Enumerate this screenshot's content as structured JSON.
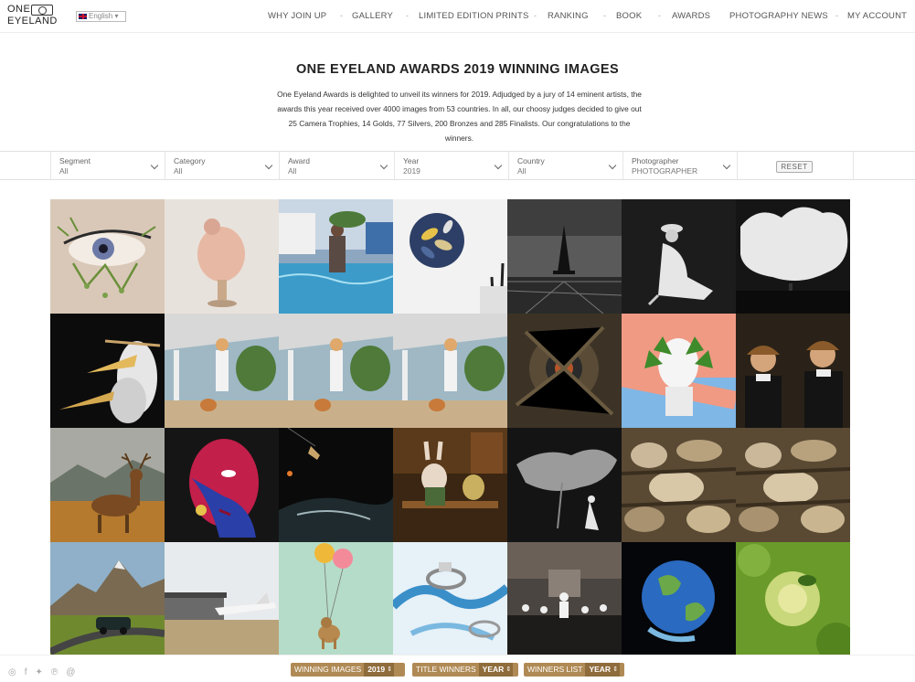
{
  "logo": {
    "line1": "ONE",
    "line2": "EYELAND"
  },
  "language": {
    "label": "English"
  },
  "nav": [
    "WHY JOIN UP",
    "GALLERY",
    "LIMITED EDITION PRINTS",
    "RANKING",
    "BOOK",
    "AWARDS",
    "PHOTOGRAPHY NEWS",
    "MY ACCOUNT"
  ],
  "page": {
    "title": "ONE EYELAND AWARDS 2019 WINNING IMAGES",
    "intro": "One Eyeland Awards is delighted to unveil its winners for 2019. Adjudged by a jury of 14 eminent artists, the awards this year received over 4000 images from 53 countries. In all, our choosy judges decided to give out 25 Camera Trophies, 14 Golds, 77 Silvers, 200 Bronzes and 285 Finalists. Our congratulations to the winners."
  },
  "filters": [
    {
      "label": "Segment",
      "value": "All"
    },
    {
      "label": "Category",
      "value": "All"
    },
    {
      "label": "Award",
      "value": "All"
    },
    {
      "label": "Year",
      "value": "2019"
    },
    {
      "label": "Country",
      "value": "All"
    },
    {
      "label": "Photographer",
      "value": "PHOTOGRAPHER"
    }
  ],
  "reset_label": "RESET",
  "gallery": {
    "tiles": [
      "eye-makeup",
      "crouching-figure",
      "poolside-woman",
      "mussel-shells",
      "eiffel-tower",
      "seated-woman-bw",
      "cloud-rider",
      "pelicans",
      "woman-with-dog",
      "woman-with-dog",
      "woman-with-dog",
      "aerial-tree",
      "green-leaf-bust",
      "boy-portraits",
      "red-deer",
      "painted-face",
      "aerial-diver",
      "rabbit-diorama",
      "tree-silhouette",
      "sculpted-figures",
      "sculpted-figures",
      "mountain-car",
      "private-jet",
      "balloon-dog",
      "ring-splash",
      "theatre-scene",
      "blue-planet",
      "green-cell"
    ]
  },
  "bottom_bar": {
    "social_icons": [
      "instagram-icon",
      "facebook-icon",
      "twitter-icon",
      "pinterest-icon",
      "email-icon"
    ],
    "buttons": [
      {
        "label": "WINNING IMAGES",
        "value": "2019"
      },
      {
        "label": "TITLE WINNERS",
        "value": "YEAR"
      },
      {
        "label": "WINNERS LIST",
        "value": "YEAR"
      }
    ]
  },
  "colors": {
    "accent": "#b08a55",
    "accent_dark": "#8f6c3c"
  }
}
